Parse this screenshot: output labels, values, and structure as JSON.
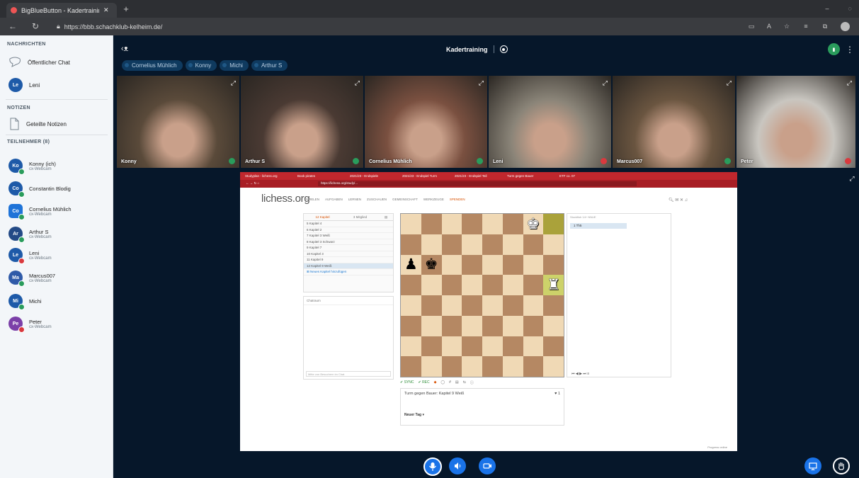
{
  "browser": {
    "tab_title": "BigBlueButton - Kadertrainin",
    "url": "https://bbb.schachklub-kelheim.de/"
  },
  "sidebar": {
    "messages_heading": "NACHRICHTEN",
    "public_chat": "Öffentlicher Chat",
    "private_chat_user": "Leni",
    "notes_heading": "NOTIZEN",
    "shared_notes": "Geteilte Notizen",
    "participants_heading": "TEILNEHMER (8)",
    "participants": [
      {
        "initials": "Ko",
        "name": "Konny (ich)",
        "sub": "cx-Webcam",
        "color": "#1e5aa8",
        "status": "#2a9c5c"
      },
      {
        "initials": "Co",
        "name": "Constantin Blodig",
        "sub": "",
        "color": "#1e5aa8",
        "status": "#2a9c5c"
      },
      {
        "initials": "Co",
        "name": "Cornelius Mühlich",
        "sub": "cx-Webcam",
        "color": "#1e73d8",
        "status": "#2a9c5c"
      },
      {
        "initials": "Ar",
        "name": "Arthur S",
        "sub": "cx-Webcam",
        "color": "#234a86",
        "status": "#2a9c5c"
      },
      {
        "initials": "Le",
        "name": "Leni",
        "sub": "cx-Webcam",
        "color": "#1e5aa8",
        "status": "#d9393e"
      },
      {
        "initials": "Ma",
        "name": "Marcus007",
        "sub": "cx-Webcam",
        "color": "#2f5aa8",
        "status": "#2a9c5c"
      },
      {
        "initials": "Mi",
        "name": "Michi",
        "sub": "",
        "color": "#1e5aa8",
        "status": "#2a9c5c"
      },
      {
        "initials": "Pe",
        "name": "Peter",
        "sub": "cx-Webcam",
        "color": "#7b3fa8",
        "status": "#d9393e"
      }
    ]
  },
  "header": {
    "title": "Kadertraining",
    "talking": [
      "Cornelius Mühlich",
      "Konny",
      "Michi",
      "Arthur S"
    ]
  },
  "videos": [
    {
      "name": "Konny",
      "mic": "#2a9c5c",
      "bg": "#5a4a3a"
    },
    {
      "name": "Arthur S",
      "mic": "#2a9c5c",
      "bg": "#4a3a33"
    },
    {
      "name": "Cornelius Mühlich",
      "mic": "#2a9c5c",
      "bg": "#7a5040"
    },
    {
      "name": "Leni",
      "mic": "#d9393e",
      "bg": "#8a8478"
    },
    {
      "name": "Marcus007",
      "mic": "#2a9c5c",
      "bg": "#6a5540"
    },
    {
      "name": "Peter",
      "mic": "#d9393e",
      "bg": "#c9c6c0"
    }
  ],
  "shared_screen": {
    "browser_tabs": [
      "Studyplan - lichess.org",
      "Book pirates",
      "2021/23 - Endspiele",
      "2021/23 - Endspiel Turm",
      "2021/23 - Endspiel Teil",
      "Turm gegen Bauer",
      "ETF co. 07"
    ],
    "url": "https://lichess.org/study/...",
    "logo": "lichess.org",
    "nav": [
      "SPIELEN",
      "AUFGABEN",
      "LERNEN",
      "ZUSCHAUEN",
      "GEMEINSCHAFT",
      "WERKZEUGE",
      "SPENDEN"
    ],
    "chapters_tab": "12 Kapitel",
    "members_tab": "3 Mitglied",
    "chapters": [
      "5 Kapitel 4",
      "6 Kapitel 2",
      "7 Kapitel 3 Weiß",
      "8 Kapitel 3 Schwarz",
      "9 Kapitel 7",
      "10 Kapitel 3",
      "11 Kapitel 9",
      "12 Kapitel 9 Weiß"
    ],
    "add_chapter": "Neues Kapitel hinzufügen",
    "chat_room": "Chatraum",
    "chat_placeholder": "Mitte von Besuchern im Chat",
    "move": "1 Th5",
    "engine_label": "Stockfish 14+ NNUE",
    "study_title": "Turm gegen Bauer: Kapitel 9 Weiß",
    "tag_label": "Neuer Tag",
    "likes": "1",
    "footer": "Progress online"
  }
}
